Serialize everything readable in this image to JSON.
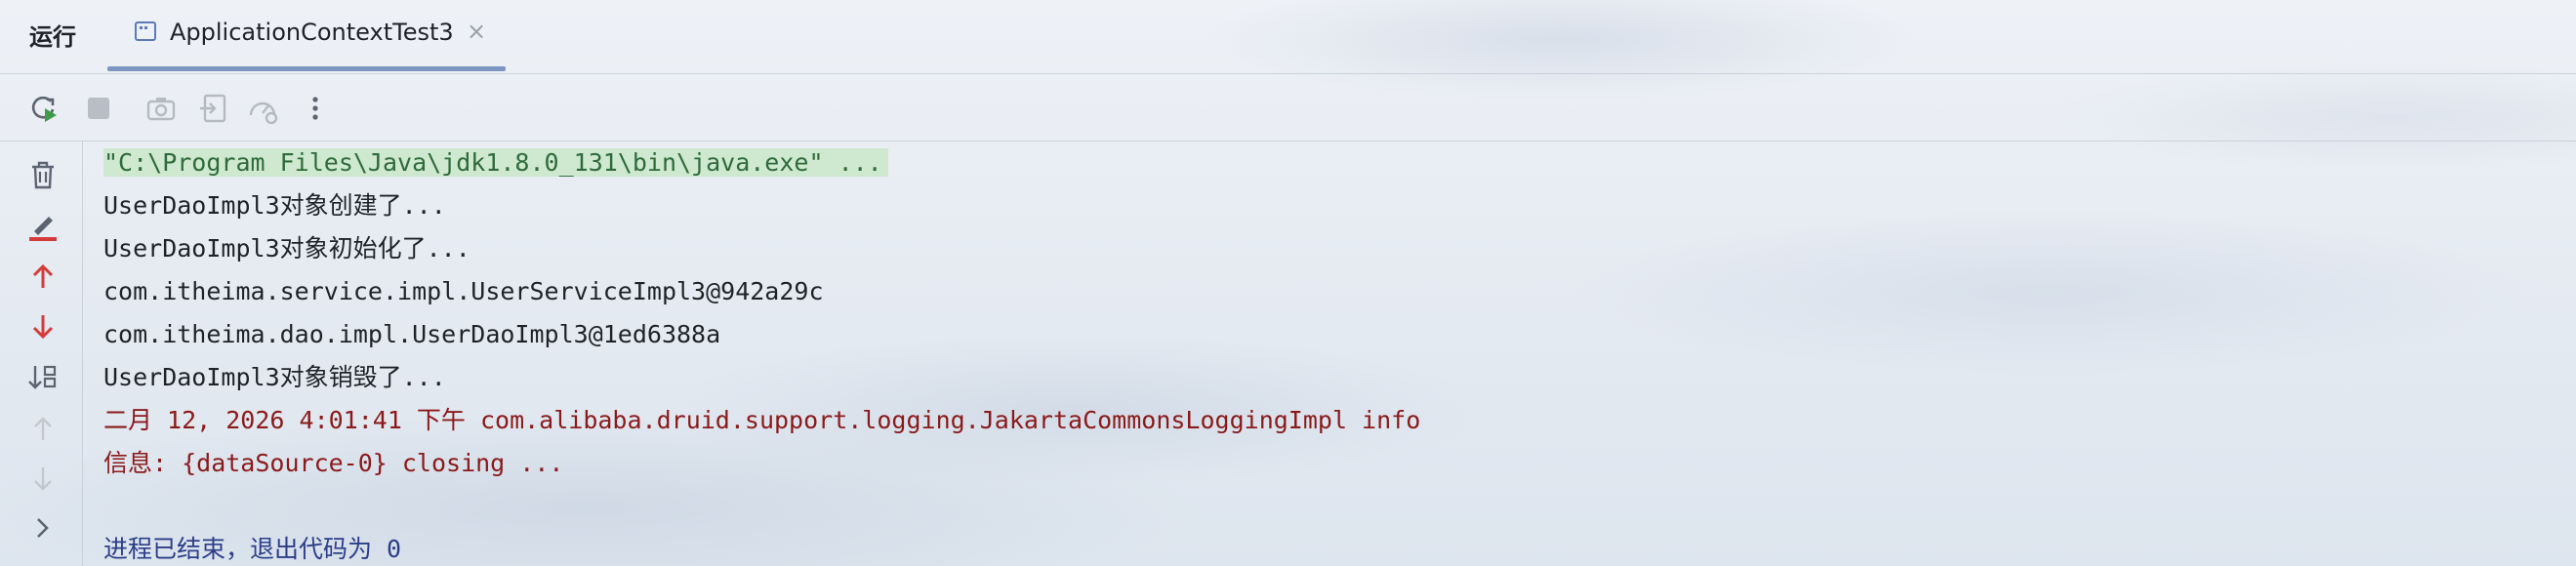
{
  "panel": {
    "run_label": "运行",
    "tab_title": "ApplicationContextTest3",
    "tab_close": "×"
  },
  "toolbar": {
    "icons": [
      "rerun-icon",
      "stop-icon",
      "screenshot-icon",
      "export-icon",
      "profiler-icon",
      "more-options-icon"
    ]
  },
  "gutter": {
    "icons": [
      "trash-icon",
      "clear-icon",
      "arrow-up-icon",
      "arrow-down-icon",
      "sort-icon",
      "up-disabled-icon",
      "down-disabled-icon",
      "expand-icon"
    ]
  },
  "console": {
    "lines": [
      "\"C:\\Program Files\\Java\\jdk1.8.0_131\\bin\\java.exe\" ...",
      "UserDaoImpl3对象创建了...",
      "UserDaoImpl3对象初始化了...",
      "com.itheima.service.impl.UserServiceImpl3@942a29c",
      "com.itheima.dao.impl.UserDaoImpl3@1ed6388a",
      "UserDaoImpl3对象销毁了...",
      "二月 12, 2026 4:01:41 下午 com.alibaba.druid.support.logging.JakartaCommonsLoggingImpl info",
      "信息: {dataSource-0} closing ...",
      "",
      "进程已结束，退出代码为 0"
    ]
  },
  "colors": {
    "command_bg": "#c6e6c4",
    "stderr": "#8b1a1a",
    "exit_text": "#2c3e8a",
    "accent_red": "#d63b3b",
    "tab_underline": "#7d95c3"
  }
}
